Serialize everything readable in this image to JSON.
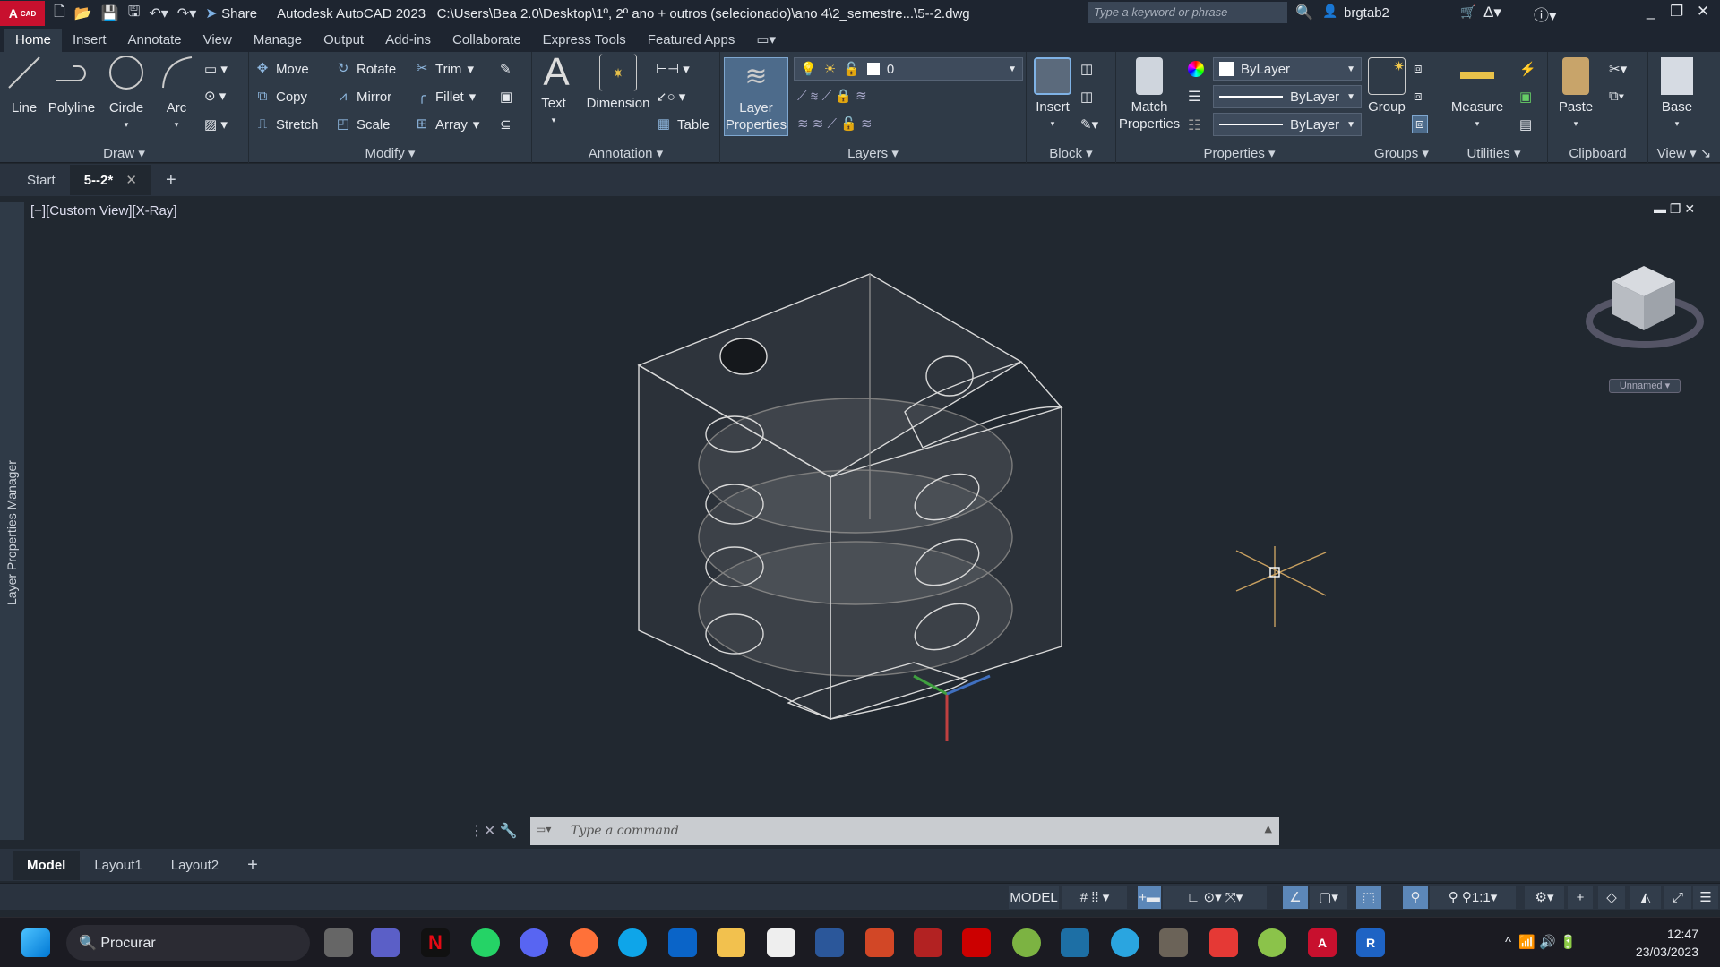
{
  "titlebar": {
    "logo": "A",
    "logo_sub": "CAD",
    "share": "Share",
    "app": "Autodesk AutoCAD 2023",
    "path": "C:\\Users\\Bea 2.0\\Desktop\\1º, 2º ano + outros (selecionado)\\ano 4\\2_semestre...\\5--2.dwg",
    "search_placeholder": "Type a keyword or phrase",
    "user": "brgtab2"
  },
  "ribbon_tabs": [
    "Home",
    "Insert",
    "Annotate",
    "View",
    "Manage",
    "Output",
    "Add-ins",
    "Collaborate",
    "Express Tools",
    "Featured Apps"
  ],
  "draw": {
    "label": "Draw",
    "line": "Line",
    "polyline": "Polyline",
    "circle": "Circle",
    "arc": "Arc"
  },
  "modify": {
    "label": "Modify",
    "move": "Move",
    "rotate": "Rotate",
    "trim": "Trim",
    "copy": "Copy",
    "mirror": "Mirror",
    "fillet": "Fillet",
    "stretch": "Stretch",
    "scale": "Scale",
    "array": "Array"
  },
  "annotation": {
    "label": "Annotation",
    "text": "Text",
    "dimension": "Dimension",
    "table": "Table"
  },
  "layers": {
    "label": "Layers",
    "layer_properties_1": "Layer",
    "layer_properties_2": "Properties",
    "current_layer": "0"
  },
  "block": {
    "label": "Block",
    "insert": "Insert"
  },
  "properties": {
    "label": "Properties",
    "match_1": "Match",
    "match_2": "Properties",
    "color": "ByLayer",
    "linetype": "ByLayer",
    "lineweight": "ByLayer"
  },
  "groups": {
    "label": "Groups",
    "group": "Group"
  },
  "utilities": {
    "label": "Utilities",
    "measure": "Measure"
  },
  "clipboard": {
    "label": "Clipboard",
    "paste": "Paste"
  },
  "view": {
    "label": "View",
    "base": "Base"
  },
  "file_tabs": {
    "start": "Start",
    "current": "5--2*"
  },
  "viewport": {
    "label": "[−][Custom View][X-Ray]",
    "viewcube_named": "Unnamed",
    "side_panel": "Layer Properties Manager"
  },
  "command": {
    "placeholder": "Type a command"
  },
  "layout_tabs": [
    "Model",
    "Layout1",
    "Layout2"
  ],
  "status": {
    "model": "MODEL",
    "scale": "1:1"
  },
  "taskbar": {
    "search": "Procurar",
    "time": "12:47",
    "date": "23/03/2023"
  }
}
